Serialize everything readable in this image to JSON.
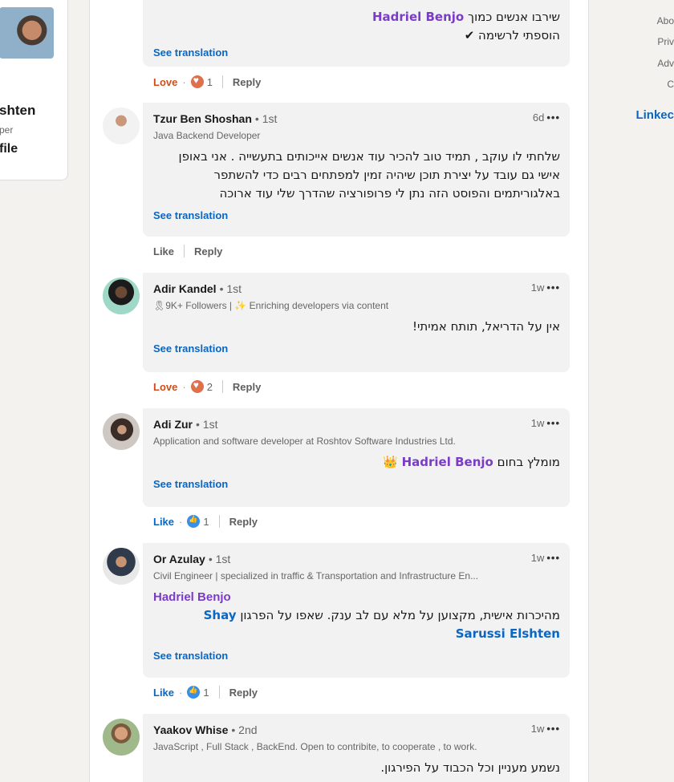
{
  "left_card": {
    "name": "shten",
    "subtitle": "per",
    "link": "file"
  },
  "right_rail": {
    "links": [
      "Abo",
      "Priv",
      "Adv",
      "C"
    ],
    "brand": "Linkec"
  },
  "top_comment": {
    "line1_prefix": "שירבו אנשים כמוך",
    "mention": "Hadriel Benjo",
    "line2": "הוספתי לרשימה ✔",
    "see_translation": "See translation",
    "reaction_label": "Love",
    "reaction_count": "1",
    "reply": "Reply"
  },
  "comments": [
    {
      "name": "Tzur Ben Shoshan",
      "degree": "• 1st",
      "headline": "Java Backend Developer",
      "time": "6d",
      "more": "•••",
      "text": "שלחתי לו עוקב , תמיד טוב להכיר עוד אנשים אייכותים בתעשייה . אני באופן אישי גם עובד על יצירת תוכן שיהיה זמין למפתחים רבים כדי להשתפר באלגוריתמים והפוסט הזה נתן לי פרופורציה שהדרך שלי עוד ארוכה",
      "see_translation": "See translation",
      "reaction_label": "Like",
      "reaction_count": "",
      "reply": "Reply"
    },
    {
      "name": "Adir Kandel",
      "degree": "• 1st",
      "headline": "🎗9K+ Followers | ✨ Enriching developers via content",
      "time": "1w",
      "more": "•••",
      "text": "אין על הדריאל, תותח אמיתי!",
      "see_translation": "See translation",
      "reaction_label": "Love",
      "reaction_count": "2",
      "reply": "Reply"
    },
    {
      "name": "Adi Zur",
      "degree": "• 1st",
      "headline": "Application and software developer at Roshtov Software Industries Ltd.",
      "time": "1w",
      "more": "•••",
      "text_prefix": "מומלץ בחום",
      "mention": "Hadriel Benjo",
      "text_suffix": "👑",
      "see_translation": "See translation",
      "reaction_label": "Like",
      "reaction_count": "1",
      "reply": "Reply"
    },
    {
      "name": "Or Azulay",
      "degree": "• 1st",
      "headline": "Civil Engineer | specialized in traffic & Transportation and Infrastructure En...",
      "time": "1w",
      "more": "•••",
      "mention_line": "Hadriel Benjo",
      "text": "מהיכרות אישית, מקצוען על מלא עם לב ענק. שאפו על הפרגון",
      "mention2": "Shay Sarussi Elshten",
      "see_translation": "See translation",
      "reaction_label": "Like",
      "reaction_count": "1",
      "reply": "Reply"
    },
    {
      "name": "Yaakov Whise",
      "degree": "• 2nd",
      "headline": "JavaScript , Full Stack , BackEnd. Open to contribite, to cooperate , to work.",
      "time": "1w",
      "more": "•••",
      "text": "נשמע מעניין וכל הכבוד על הפירגון."
    }
  ]
}
